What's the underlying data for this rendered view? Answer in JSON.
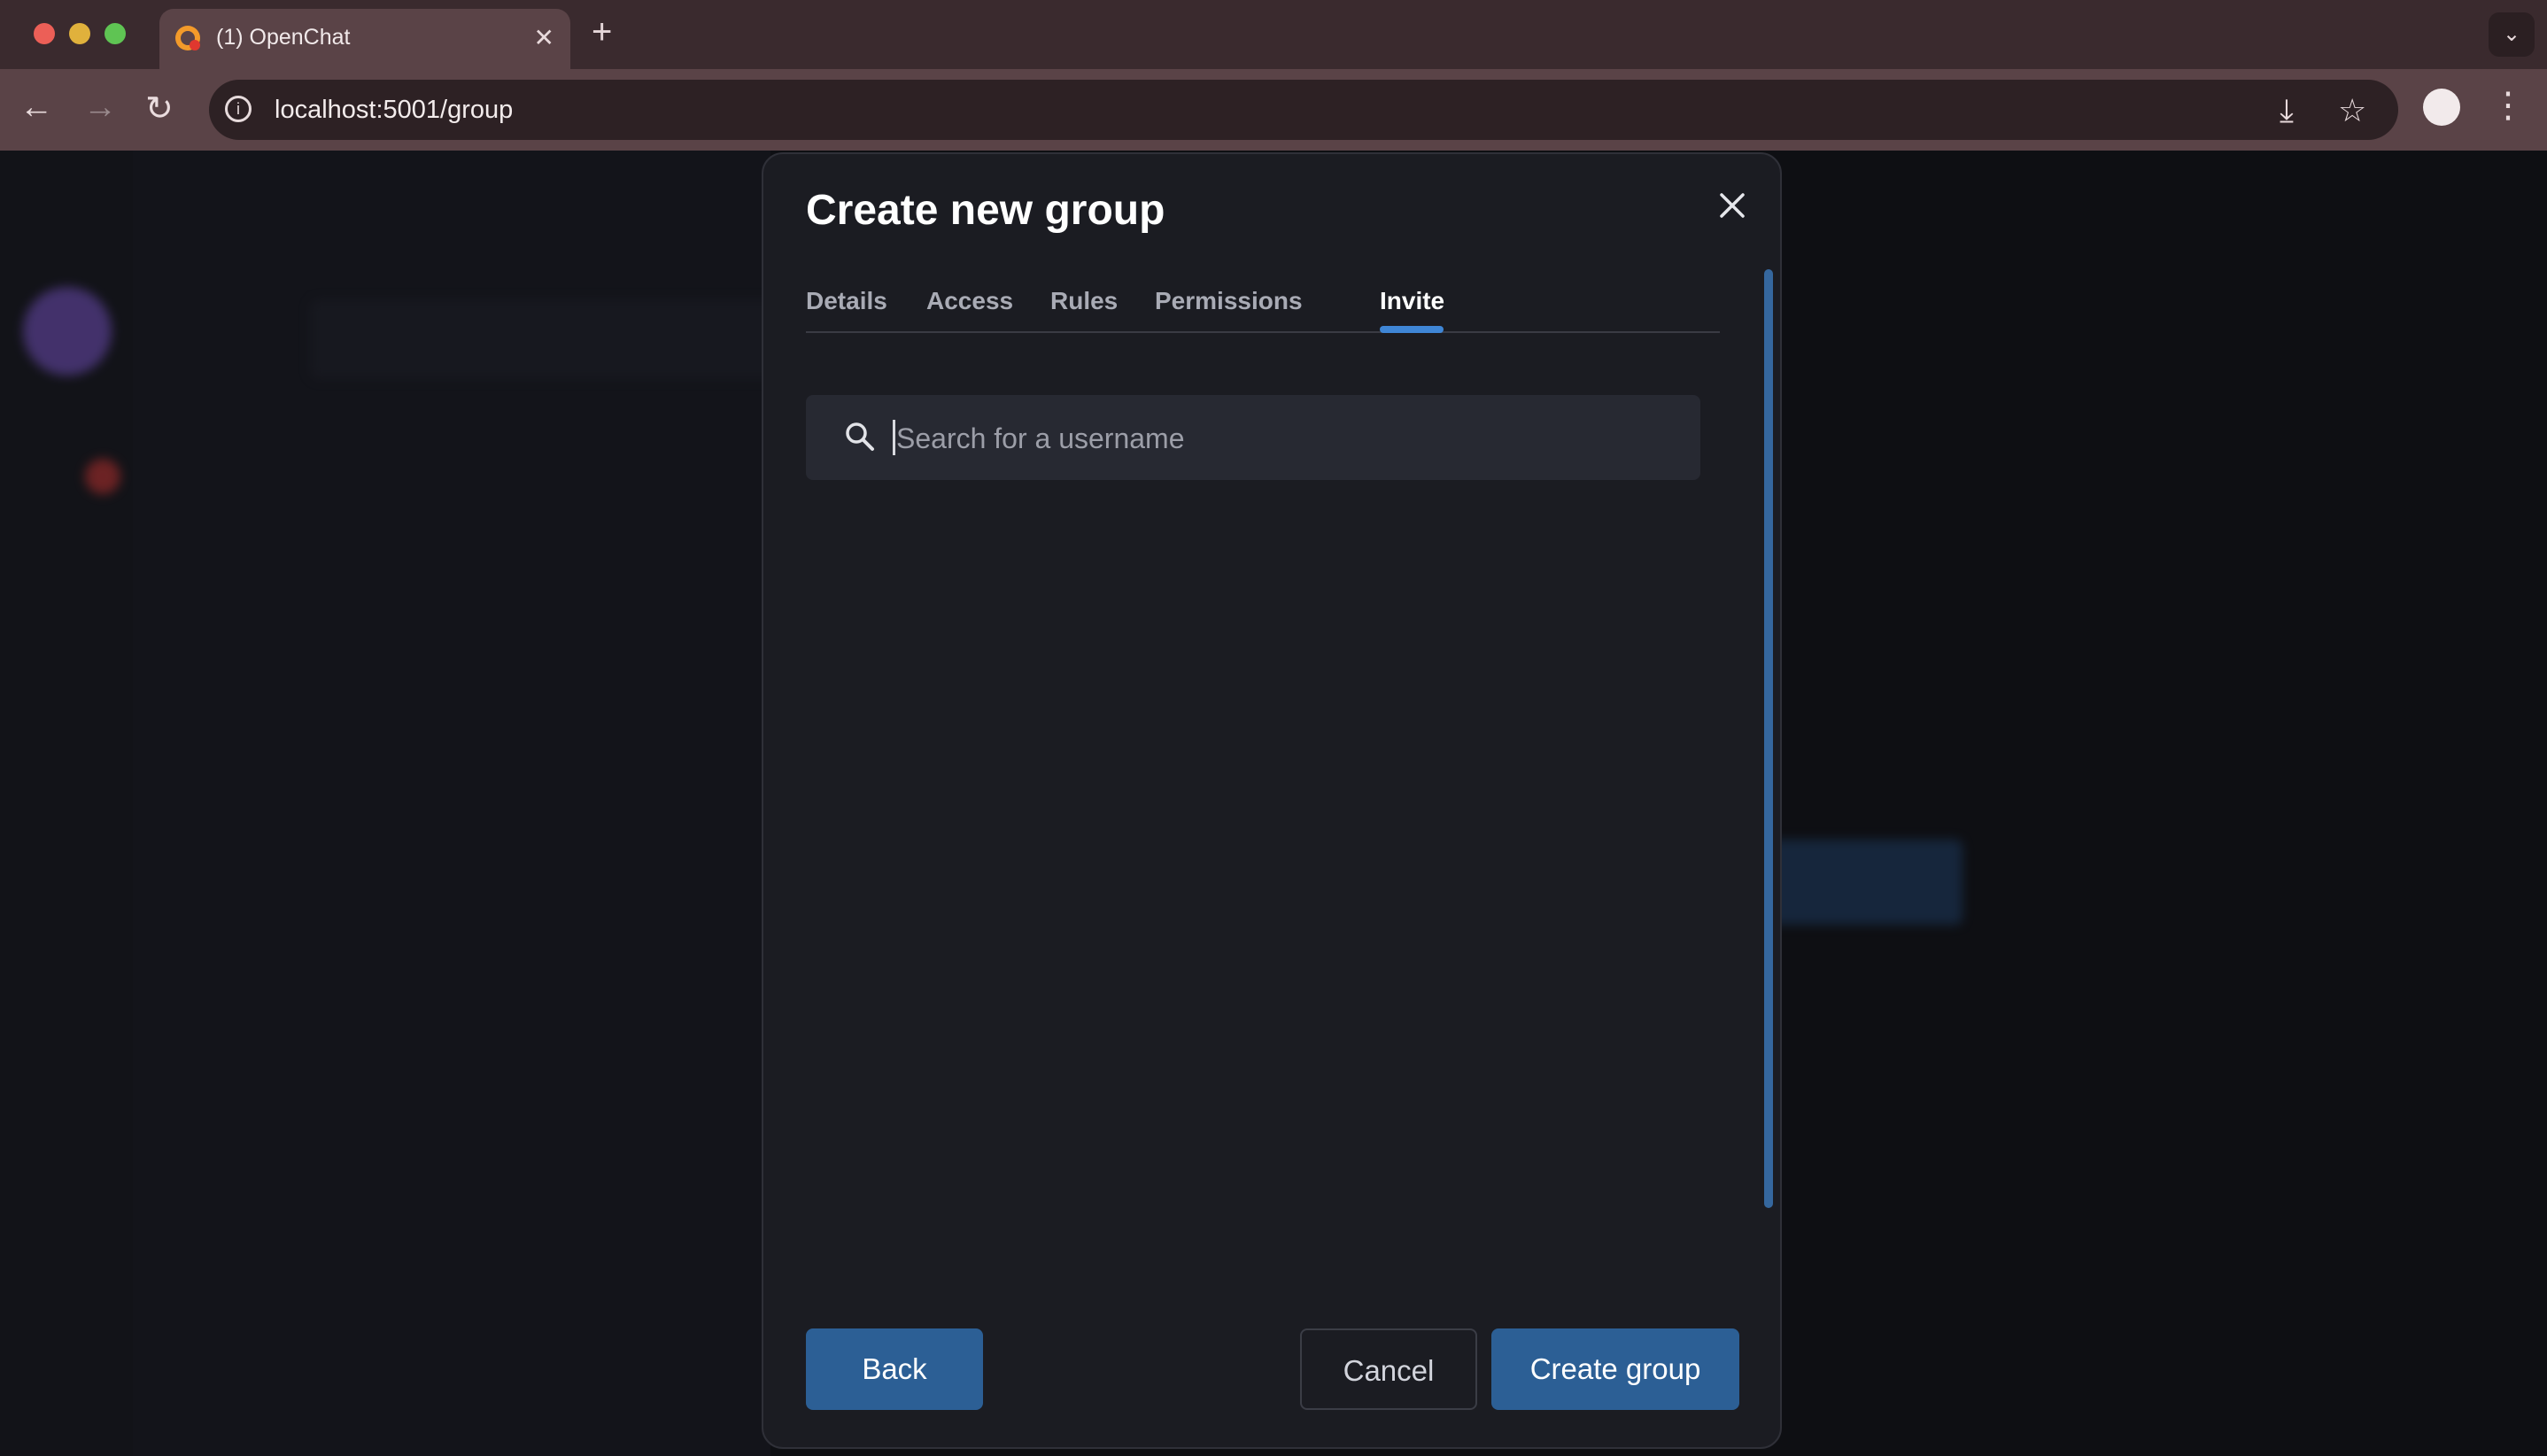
{
  "browser": {
    "tab_title": "(1) OpenChat",
    "tab_close": "✕",
    "new_tab": "+",
    "tab_menu": "⌄",
    "url": "localhost:5001/group",
    "nav": {
      "back": "←",
      "forward": "→",
      "reload": "↻"
    },
    "info_glyph": "i",
    "install_glyph": "⤓",
    "bookmark_glyph": "☆",
    "menu_glyph": "⋮"
  },
  "modal": {
    "title": "Create new group",
    "tabs": [
      {
        "label": "Details"
      },
      {
        "label": "Access"
      },
      {
        "label": "Rules"
      },
      {
        "label": "Permissions"
      },
      {
        "label": "Invite",
        "active": true
      }
    ],
    "search_placeholder": "Search for a username",
    "buttons": {
      "back": "Back",
      "cancel": "Cancel",
      "create": "Create group"
    }
  },
  "colors": {
    "accent": "#3f86d6",
    "primary_button": "#2c5f95",
    "modal_bg": "#1b1c22"
  }
}
